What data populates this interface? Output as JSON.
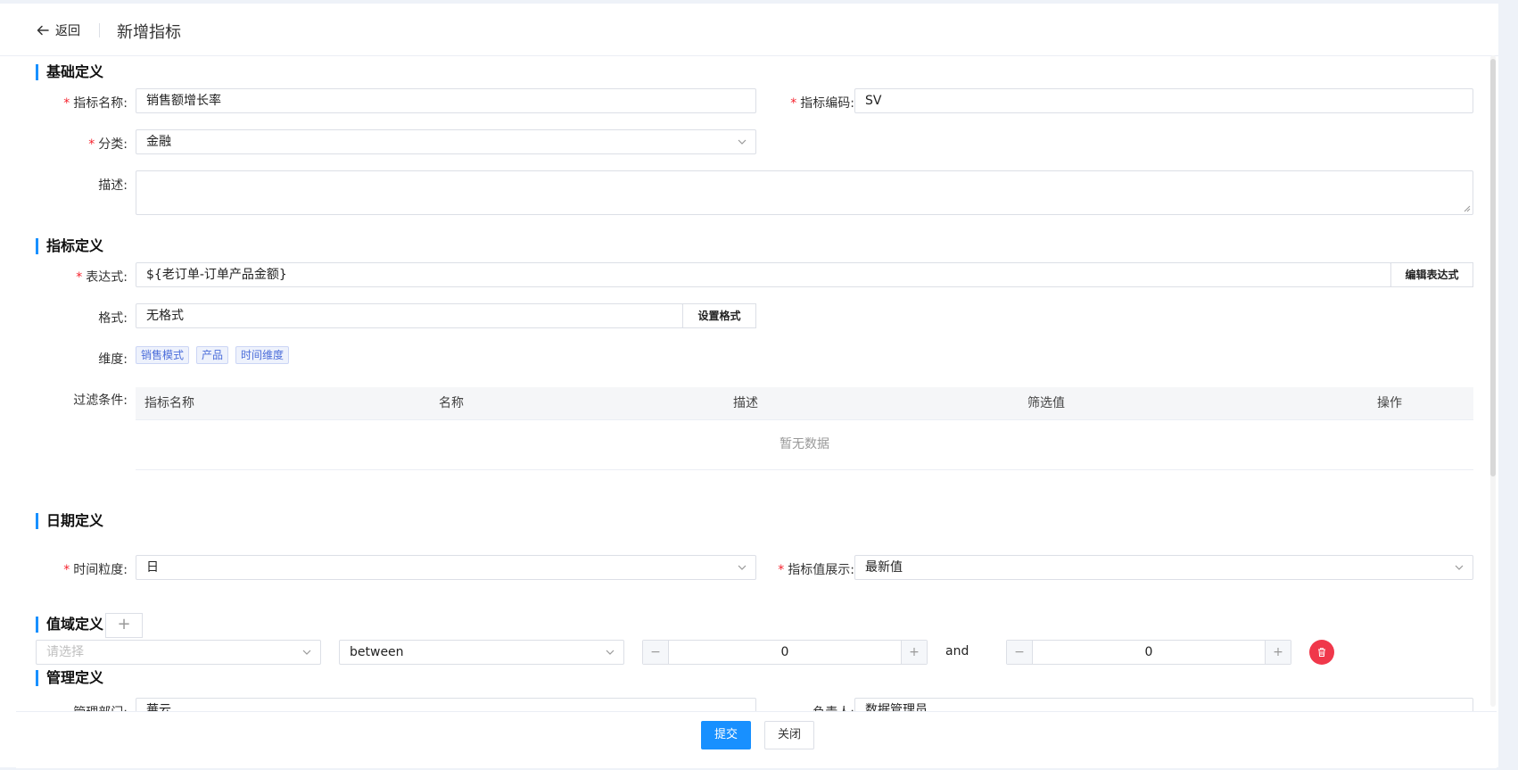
{
  "header": {
    "back_label": "返回",
    "title": "新增指标"
  },
  "basic": {
    "section_title": "基础定义",
    "name_label": "指标名称:",
    "name_value": "销售额增长率",
    "code_label": "指标编码:",
    "code_value": "SV",
    "category_label": "分类:",
    "category_value": "金融",
    "desc_label": "描述:",
    "desc_value": ""
  },
  "definition": {
    "section_title": "指标定义",
    "expr_label": "表达式:",
    "expr_value": "${老订单-订单产品金额}",
    "expr_button": "编辑表达式",
    "format_label": "格式:",
    "format_value": "无格式",
    "format_button": "设置格式",
    "dims_label": "维度:",
    "dims": [
      "销售模式",
      "产品",
      "时间维度"
    ],
    "filter_label": "过滤条件:",
    "filter_columns": [
      "指标名称",
      "名称",
      "描述",
      "筛选值",
      "操作"
    ],
    "filter_empty": "暂无数据"
  },
  "date": {
    "section_title": "日期定义",
    "granularity_label": "时间粒度:",
    "granularity_value": "日",
    "display_label": "指标值展示:",
    "display_value": "最新值"
  },
  "range": {
    "section_title": "值域定义",
    "add_label": "+",
    "field_placeholder": "请选择",
    "operator_value": "between",
    "min_value": "0",
    "and_text": "and",
    "max_value": "0",
    "minus_glyph": "−",
    "plus_glyph": "+"
  },
  "management": {
    "section_title": "管理定义",
    "dept_label": "管理部门:",
    "dept_value": "華云",
    "owner_label": "负责人:",
    "owner_value": "数据管理员"
  },
  "footer": {
    "submit_label": "提交",
    "close_label": "关闭"
  },
  "colors": {
    "accent": "#1890ff",
    "required": "#f5222d",
    "danger": "#f0384b",
    "tag_text": "#4c6eda"
  }
}
